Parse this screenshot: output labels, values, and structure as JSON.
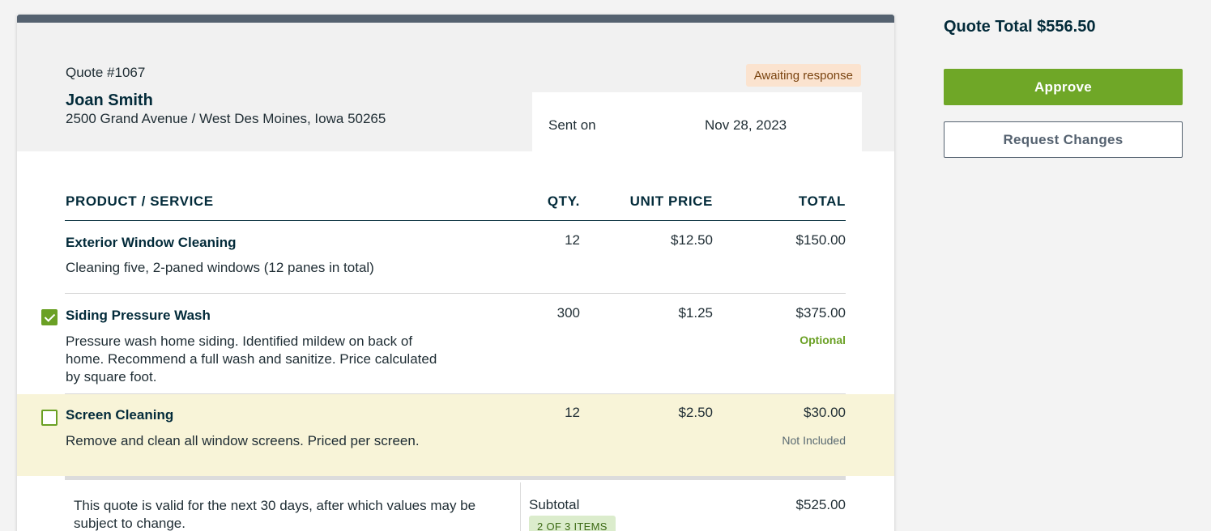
{
  "quote": {
    "number": "Quote #1067",
    "client_name": "Joan Smith",
    "address": "2500 Grand Avenue / West Des Moines, Iowa 50265",
    "status": "Awaiting response",
    "sent_label": "Sent on",
    "sent_date": "Nov 28, 2023"
  },
  "table": {
    "headers": {
      "product": "PRODUCT / SERVICE",
      "qty": "QTY.",
      "unit_price": "UNIT PRICE",
      "total": "TOTAL"
    },
    "rows": [
      {
        "name": "Exterior Window Cleaning",
        "description": "Cleaning five, 2-paned windows (12 panes in total)",
        "qty": "12",
        "unit_price": "$12.50",
        "total": "$150.00",
        "tag": ""
      },
      {
        "name": "Siding Pressure Wash",
        "description": "Pressure wash home siding. Identified mildew on back of home. Recommend a full wash and sanitize. Price calculated by square foot.",
        "qty": "300",
        "unit_price": "$1.25",
        "total": "$375.00",
        "tag": "Optional",
        "checked": true
      },
      {
        "name": "Screen Cleaning",
        "description": "Remove and clean all window screens. Priced per screen.",
        "qty": "12",
        "unit_price": "$2.50",
        "total": "$30.00",
        "tag": "Not Included",
        "checked": false
      }
    ]
  },
  "footer": {
    "valid_text": "This quote is valid for the next 30 days, after which values may be subject to change.",
    "subtotal_label": "Subtotal",
    "subtotal_value": "$525.00",
    "items_badge": "2 OF 3 ITEMS"
  },
  "sidebar": {
    "total": "Quote Total $556.50",
    "approve_label": "Approve",
    "request_changes_label": "Request Changes"
  },
  "colors": {
    "accent_green": "#6fa727",
    "header_bar": "#556270",
    "highlight_row": "#f8f4d8",
    "status_badge_bg": "#fbe3cf"
  }
}
